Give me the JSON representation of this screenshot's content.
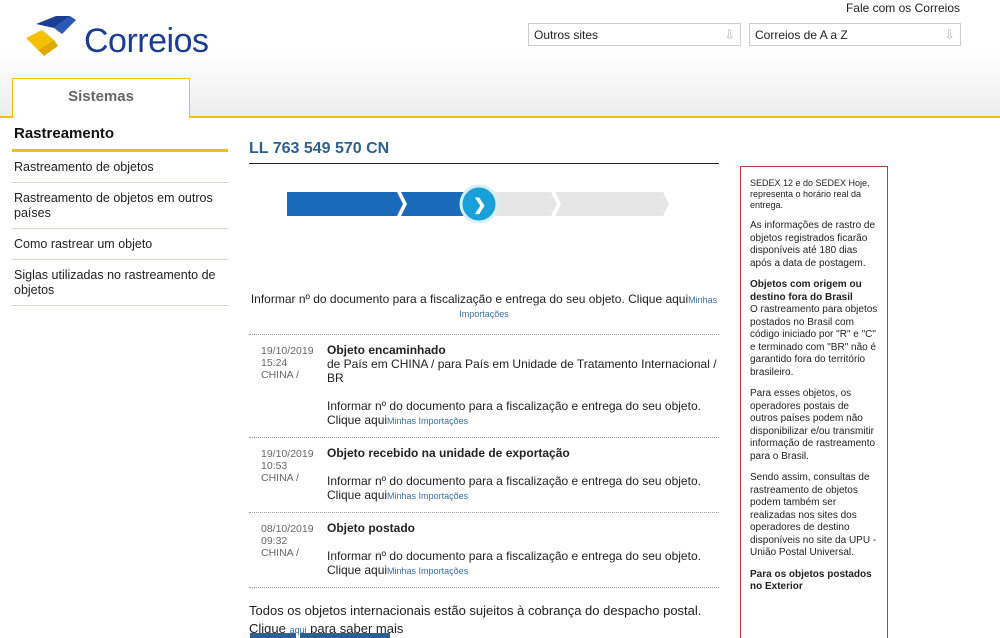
{
  "header": {
    "logo_text": "Correios",
    "contact_link": "Fale com os Correios",
    "select_other_sites": "Outros sites",
    "select_a_to_z": "Correios de A a Z",
    "tab_label": "Sistemas"
  },
  "colors": {
    "brand_blue": "#1a3d8f",
    "brand_yellow": "#f2c200",
    "progress_blue": "#1a6aba",
    "link": "#3a6ea5"
  },
  "sidebar": {
    "title": "Rastreamento",
    "items": [
      {
        "label": "Rastreamento de objetos"
      },
      {
        "label": "Rastreamento de objetos em outros países"
      },
      {
        "label": "Como rastrear um objeto"
      },
      {
        "label": "Siglas utilizadas no rastreamento de objetos"
      }
    ]
  },
  "main": {
    "tracking_code": "LL 763 549 570 CN",
    "progress_steps_completed": 3,
    "progress_steps_total": 5,
    "intro_text": "Informar nº do documento para a fiscalização e entrega do seu objeto. Clique aqui",
    "intro_link": "Minhas Importações",
    "events": [
      {
        "date": "19/10/2019",
        "time": "15:24",
        "location": "CHINA /",
        "status": "Objeto encaminhado",
        "detail": "de País em CHINA / para País em Unidade de Tratamento Internacional / BR",
        "info": "Informar nº do documento para a fiscalização e entrega do seu objeto.",
        "click": "Clique aqui",
        "link": "Minhas Importações"
      },
      {
        "date": "19/10/2019",
        "time": "10:53",
        "location": "CHINA /",
        "status": "Objeto recebido na unidade de exportação",
        "detail": "",
        "info": "Informar nº do documento para a fiscalização e entrega do seu objeto.",
        "click": "Clique aqui",
        "link": "Minhas Importações"
      },
      {
        "date": "08/10/2019",
        "time": "09:32",
        "location": "CHINA /",
        "status": "Objeto postado",
        "detail": "",
        "info": "Informar nº do documento para a fiscalização e entrega do seu objeto.",
        "click": "Clique aqui",
        "link": "Minhas Importações"
      }
    ],
    "footer_text_1": "Todos os objetos internacionais estão sujeitos à cobrança do despacho postal.",
    "footer_click": "Clique",
    "footer_link": "aqui",
    "footer_text_2": "para saber mais"
  },
  "right_box": {
    "p1": "SEDEX 12 e do SEDEX Hoje, representa o horário real da entrega.",
    "p2": "As informações de rastro de objetos registrados ficarão disponíveis até 180 dias após a data de postagem.",
    "h3": "Objetos com origem ou destino fora do Brasil",
    "p3": "O rastreamento para objetos postados no Brasil com código iniciado por \"R\" e \"C\" e terminado com \"BR\" não é garantido fora do território brasileiro.",
    "p4": "Para esses objetos, os operadores postais de outros países podem não disponibilizar e/ou transmitir informação de rastreamento para o Brasil.",
    "p5": "Sendo assim, consultas de rastreamento de objetos podem também ser realizadas nos sites dos operadores de destino disponíveis no site da UPU - União Postal Universal.",
    "h6": "Para os objetos postados no Exterior"
  }
}
